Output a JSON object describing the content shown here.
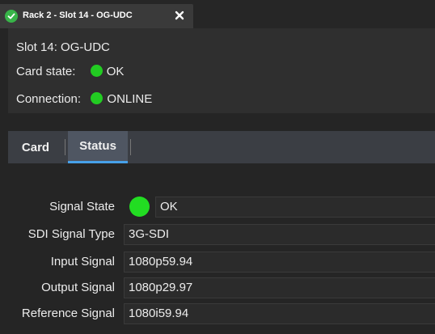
{
  "window": {
    "tab_title": "Rack 2 - Slot 14 - OG-UDC"
  },
  "card_info": {
    "slot_line": "Slot 14: OG-UDC",
    "card_state_label": "Card state:",
    "card_state_value": "OK",
    "connection_label": "Connection:",
    "connection_value": "ONLINE",
    "status_color": "#22cc22"
  },
  "subtabs": [
    {
      "label": "Card",
      "active": false
    },
    {
      "label": "Status",
      "active": true
    }
  ],
  "status_rows": [
    {
      "label": "Signal State",
      "value": "OK",
      "indicator": "green"
    },
    {
      "label": "SDI Signal Type",
      "value": "3G-SDI"
    },
    {
      "label": "Input Signal",
      "value": "1080p59.94"
    },
    {
      "label": "Output Signal",
      "value": "1080p29.97"
    },
    {
      "label": "Reference Signal",
      "value": "1080i59.94"
    }
  ],
  "icons": {
    "tab_status": "check-circle-icon",
    "tab_close": "close-icon"
  },
  "colors": {
    "accent": "#47a1ea",
    "ok_green": "#22dd22"
  }
}
